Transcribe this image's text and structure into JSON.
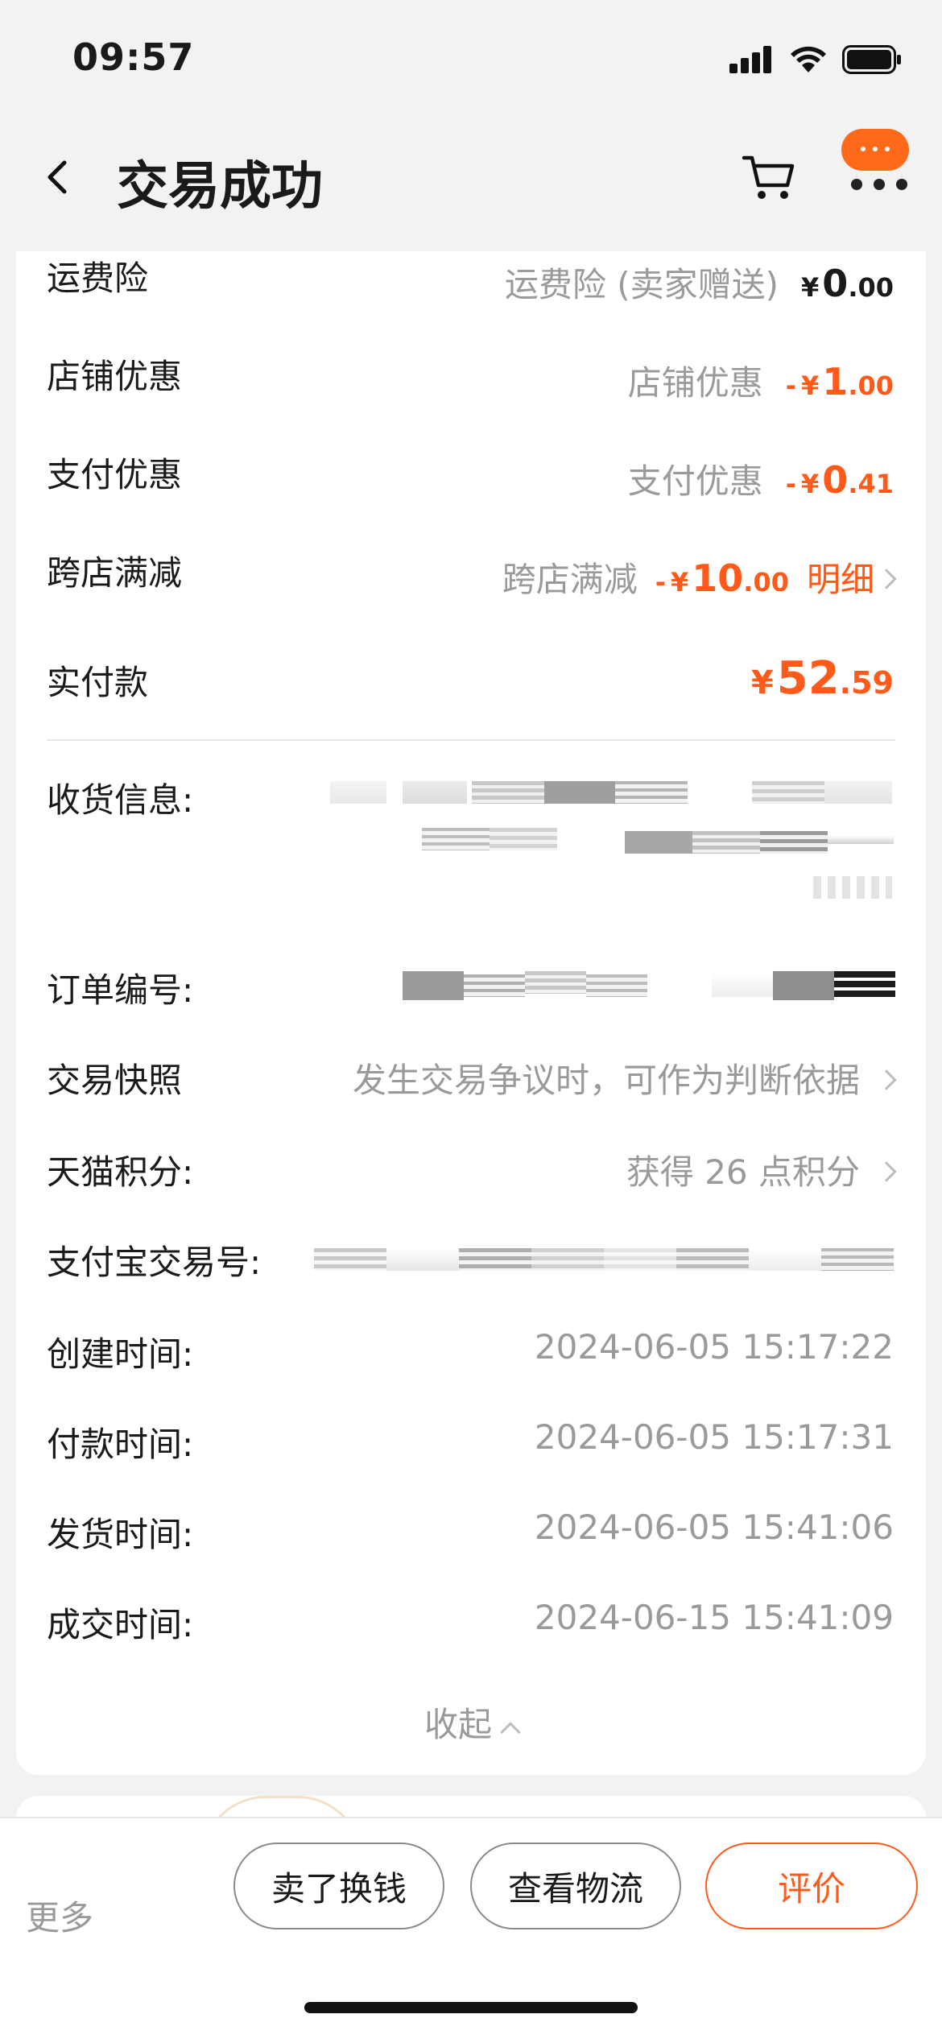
{
  "status_bar": {
    "time": "09:57"
  },
  "nav": {
    "title": "交易成功"
  },
  "fees": {
    "shipping_insurance": {
      "label": "运费险",
      "desc": "运费险 (卖家赠送)",
      "symbol": "¥",
      "int": "0",
      "dec": ".00"
    },
    "store_discount": {
      "label": "店铺优惠",
      "desc": "店铺优惠",
      "minus": "-",
      "symbol": "¥",
      "int": "1",
      "dec": ".00"
    },
    "payment_discount": {
      "label": "支付优惠",
      "desc": "支付优惠",
      "minus": "-",
      "symbol": "¥",
      "int": "0",
      "dec": ".41"
    },
    "cross_store": {
      "label": "跨店满减",
      "desc": "跨店满减",
      "minus": "-",
      "symbol": "¥",
      "int": "10",
      "dec": ".00",
      "detail": "明细"
    },
    "paid": {
      "label": "实付款",
      "symbol": "¥",
      "int": "52",
      "dec": ".59"
    }
  },
  "info": {
    "shipping_label": "收货信息:",
    "order_no_label": "订单编号:",
    "snapshot_label": "交易快照",
    "snapshot_value": "发生交易争议时，可作为判断依据",
    "points_label": "天猫积分:",
    "points_value": "获得 26 点积分",
    "alipay_label": "支付宝交易号:",
    "created_label": "创建时间:",
    "created_value": "2024-06-05 15:17:22",
    "paid_label": "付款时间:",
    "paid_value": "2024-06-05 15:17:31",
    "shipped_label": "发货时间:",
    "shipped_value": "2024-06-05 15:41:06",
    "done_label": "成交时间:",
    "done_value": "2024-06-15 15:41:09"
  },
  "collapse_label": "收起",
  "bottom": {
    "more": "更多",
    "sell": "卖了换钱",
    "logistics": "查看物流",
    "review": "评价"
  },
  "colors": {
    "accent": "#ff5a1a",
    "muted": "#9a9a9a"
  }
}
